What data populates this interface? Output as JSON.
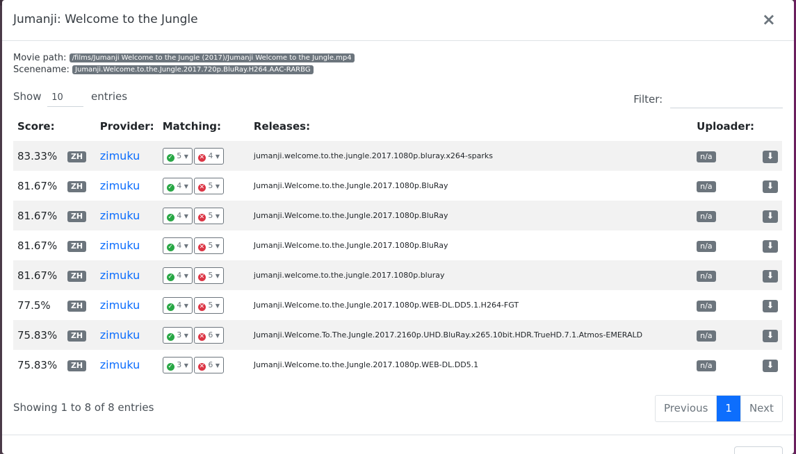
{
  "modal": {
    "title": "Jumanji: Welcome to the Jungle",
    "close_label": "×"
  },
  "info": {
    "movie_path_label": "Movie path:",
    "movie_path": "/films/Jumanji Welcome to the Jungle (2017)/Jumanji Welcome to the Jungle.mp4",
    "scenename_label": "Scenename:",
    "scenename": "Jumanji.Welcome.to.the.Jungle.2017.720p.BluRay.H264.AAC-RARBG"
  },
  "controls": {
    "show_label": "Show",
    "entries_value": "10",
    "entries_label": "entries",
    "filter_label": "Filter:"
  },
  "table": {
    "headers": {
      "score": "Score:",
      "provider": "Provider:",
      "matching": "Matching:",
      "releases": "Releases:",
      "uploader": "Uploader:"
    },
    "rows": [
      {
        "score": "83.33%",
        "lang": "ZH",
        "provider": "zimuku",
        "match": "5",
        "miss": "4",
        "release": "jumanji.welcome.to.the.jungle.2017.1080p.bluray.x264-sparks",
        "uploader": "n/a"
      },
      {
        "score": "81.67%",
        "lang": "ZH",
        "provider": "zimuku",
        "match": "4",
        "miss": "5",
        "release": "Jumanji.Welcome.to.the.Jungle.2017.1080p.BluRay",
        "uploader": "n/a"
      },
      {
        "score": "81.67%",
        "lang": "ZH",
        "provider": "zimuku",
        "match": "4",
        "miss": "5",
        "release": "Jumanji.Welcome.to.the.Jungle.2017.1080p.BluRay",
        "uploader": "n/a"
      },
      {
        "score": "81.67%",
        "lang": "ZH",
        "provider": "zimuku",
        "match": "4",
        "miss": "5",
        "release": "Jumanji.Welcome.to.the.Jungle.2017.1080p.BluRay",
        "uploader": "n/a"
      },
      {
        "score": "81.67%",
        "lang": "ZH",
        "provider": "zimuku",
        "match": "4",
        "miss": "5",
        "release": "jumanji.welcome.to.the.jungle.2017.1080p.bluray",
        "uploader": "n/a"
      },
      {
        "score": "77.5%",
        "lang": "ZH",
        "provider": "zimuku",
        "match": "4",
        "miss": "5",
        "release": "Jumanji.Welcome.to.the.Jungle.2017.1080p.WEB-DL.DD5.1.H264-FGT",
        "uploader": "n/a"
      },
      {
        "score": "75.83%",
        "lang": "ZH",
        "provider": "zimuku",
        "match": "3",
        "miss": "6",
        "release": "Jumanji.Welcome.To.The.Jungle.2017.2160p.UHD.BluRay.x265.10bit.HDR.TrueHD.7.1.Atmos-EMERALD",
        "uploader": "n/a"
      },
      {
        "score": "75.83%",
        "lang": "ZH",
        "provider": "zimuku",
        "match": "3",
        "miss": "6",
        "release": "Jumanji.Welcome.to.the.Jungle.2017.1080p.WEB-DL.DD5.1",
        "uploader": "n/a"
      }
    ]
  },
  "footer": {
    "showing": "Showing 1 to 8 of 8 entries",
    "previous": "Previous",
    "page": "1",
    "next": "Next"
  },
  "icons": {
    "check": "check-circle-icon",
    "cross": "times-circle-icon",
    "download": "download-icon"
  },
  "colors": {
    "primary": "#0d6efd",
    "badge": "#6c757d",
    "success": "#28a745",
    "danger": "#dc3545"
  }
}
